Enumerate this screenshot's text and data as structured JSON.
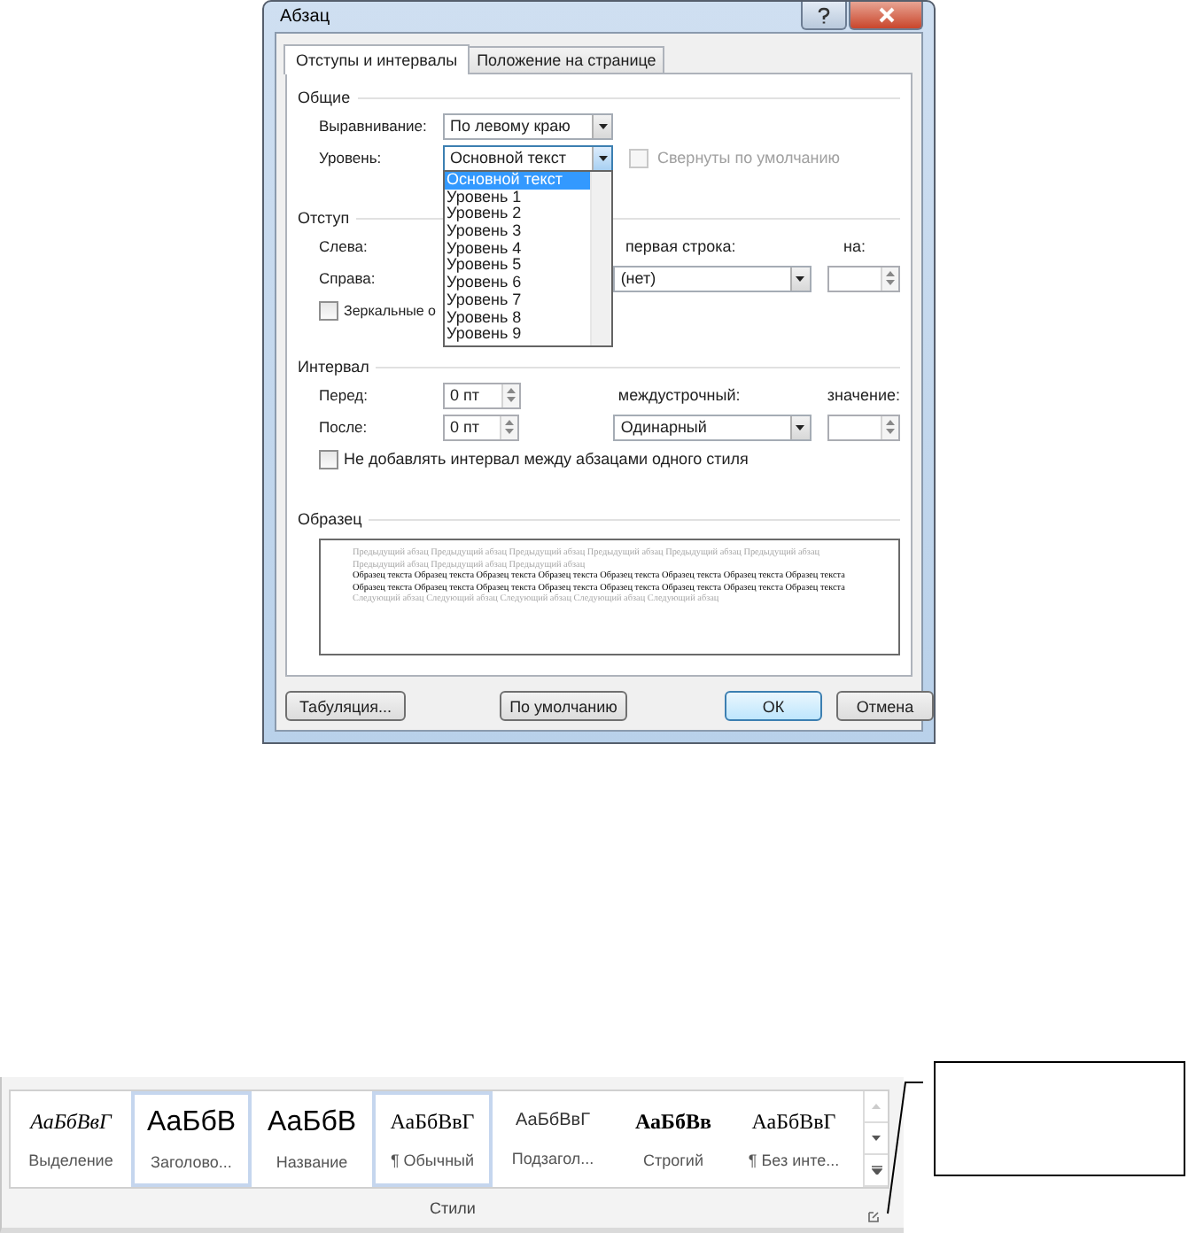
{
  "dialog": {
    "title": "Абзац"
  },
  "tabs": [
    {
      "label": "Отступы и интервалы",
      "selected": true
    },
    {
      "label": "Положение на странице",
      "selected": false
    }
  ],
  "general": {
    "heading": "Общие",
    "alignment": {
      "label": "Выравнивание:",
      "value": "По левому краю"
    },
    "level": {
      "label": "Уровень:",
      "value": "Основной текст",
      "expanded": true
    },
    "collapsed": {
      "label": "Свернуты по умолчанию",
      "checked": false,
      "disabled": true
    }
  },
  "level_options": [
    {
      "label": "Основной текст",
      "selected": true
    },
    {
      "label": "Уровень 1",
      "selected": false
    },
    {
      "label": "Уровень 2",
      "selected": false
    },
    {
      "label": "Уровень 3",
      "selected": false
    },
    {
      "label": "Уровень 4",
      "selected": false
    },
    {
      "label": "Уровень 5",
      "selected": false
    },
    {
      "label": "Уровень 6",
      "selected": false
    },
    {
      "label": "Уровень 7",
      "selected": false
    },
    {
      "label": "Уровень 8",
      "selected": false
    },
    {
      "label": "Уровень 9",
      "selected": false
    }
  ],
  "indent": {
    "heading": "Отступ",
    "left_label": "Слева:",
    "right_label": "Справа:",
    "first_line": {
      "label": "первая строка:",
      "value": "(нет)"
    },
    "by": {
      "label": "на:"
    },
    "mirror": {
      "label": "Зеркальные о",
      "checked": false
    }
  },
  "spacing": {
    "heading": "Интервал",
    "before": {
      "label": "Перед:",
      "value": "0 пт"
    },
    "after": {
      "label": "После:",
      "value": "0 пт"
    },
    "line_spacing": {
      "label": "междустрочный:",
      "value": "Одинарный"
    },
    "at": {
      "label": "значение:"
    },
    "dont_add": {
      "label": "Не добавлять интервал между абзацами одного стиля",
      "checked": false
    }
  },
  "preview": {
    "heading": "Образец",
    "previous": "Предыдущий абзац Предыдущий абзац Предыдущий абзац Предыдущий абзац Предыдущий абзац Предыдущий абзац Предыдущий абзац Предыдущий абзац Предыдущий абзац",
    "sample": "Образец текста Образец текста Образец текста Образец текста Образец текста Образец текста Образец текста Образец текста Образец текста Образец текста Образец текста Образец текста Образец текста Образец текста Образец текста Образец текста",
    "next": "Следующий абзац Следующий абзац Следующий абзац Следующий абзац Следующий абзац"
  },
  "buttons": [
    {
      "label": "Табуляция...",
      "kind": "normal"
    },
    {
      "label": "По умолчанию",
      "kind": "normal"
    },
    {
      "label": "ОК",
      "kind": "default"
    },
    {
      "label": "Отмена",
      "kind": "normal"
    }
  ],
  "ribbon": {
    "group_label": "Стили",
    "styles": [
      {
        "sample": "АаБбВвГ",
        "label": "Выделение",
        "kind": "italic",
        "selected": false
      },
      {
        "sample": "АаБбВ",
        "label": "Заголово...",
        "kind": "heading",
        "selected": true
      },
      {
        "sample": "АаБбВ",
        "label": "Название",
        "kind": "title",
        "selected": false
      },
      {
        "sample": "АаБбВвГ",
        "label": "¶ Обычный",
        "kind": "normal",
        "selected": true
      },
      {
        "sample": "АаБбВвГ",
        "label": "Подзагол...",
        "kind": "subtitle",
        "selected": false
      },
      {
        "sample": "АаБбВв",
        "label": "Строгий",
        "kind": "strong",
        "selected": false
      },
      {
        "sample": "АаБбВвГ",
        "label": "¶ Без инте...",
        "kind": "normal",
        "selected": false
      }
    ]
  }
}
